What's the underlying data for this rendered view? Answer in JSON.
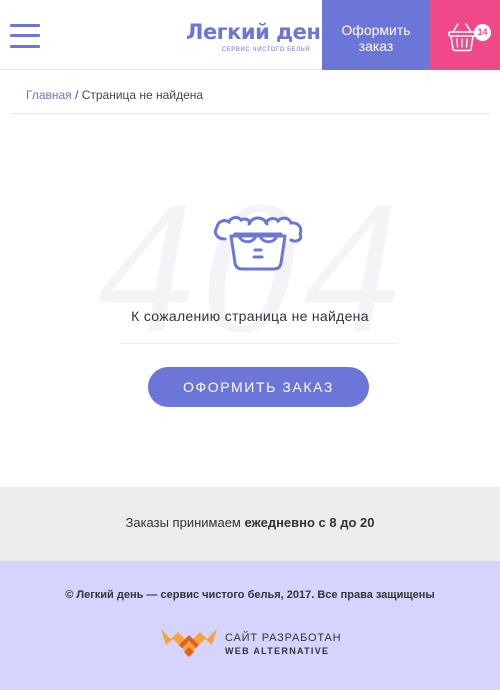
{
  "header": {
    "logo_title": "Легкий день",
    "logo_subtitle": "сервис чистого белья",
    "order_line1": "Оформить",
    "order_line2": "заказ",
    "cart_count": "14"
  },
  "breadcrumb": {
    "home": "Главная",
    "separator": " / ",
    "current": "Страница не найдена"
  },
  "error": {
    "code": "404",
    "message": "К сожалению страница не найдена",
    "button": "Оформить заказ"
  },
  "hours": {
    "prefix": "Заказы  принимаем ",
    "value": "ежедневно с 8 до 20"
  },
  "footer": {
    "copyright": "© Легкий день — сервис чистого белья, 2017. Все права защищены",
    "dev_line1": "САЙТ РАЗРАБОТАН",
    "dev_line2": "WEB ALTERNATIVE"
  },
  "colors": {
    "accent": "#6b76d8",
    "cart": "#f0498a",
    "footer": "#d4d4fe",
    "hours_bg": "#ececec"
  },
  "icons": [
    "menu-icon",
    "basket-icon",
    "laundry-basin-icon",
    "web-alternative-logo-icon"
  ]
}
